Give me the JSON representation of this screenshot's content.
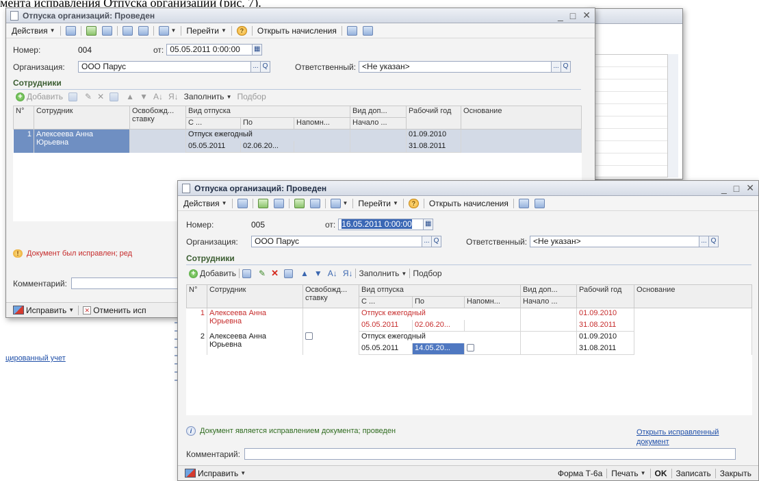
{
  "page_text": "мента исправления Отпуска организаций (рис. 7).",
  "background": {
    "link_text": "цированный учет"
  },
  "win1": {
    "title": "Отпуска организаций: Проведен",
    "toolbar": {
      "actions": "Действия",
      "goto": "Перейти",
      "open_accruals": "Открыть начисления"
    },
    "number_label": "Номер:",
    "number_value": "004",
    "date_label": "от:",
    "date_value": "05.05.2011  0:00:00",
    "org_label": "Организация:",
    "org_value": "ООО Парус",
    "resp_label": "Ответственный:",
    "resp_value": "<Не указан>",
    "section": "Сотрудники",
    "grid_toolbar": {
      "add": "Добавить",
      "fill": "Заполнить",
      "pick": "Подбор"
    },
    "columns": {
      "n": "N°",
      "employee": "Сотрудник",
      "release": "Освобожд... ставку",
      "vac_type": "Вид отпуска",
      "vac_from": "С ...",
      "vac_to": "По",
      "remind": "Напомн...",
      "extra": "Вид доп...",
      "extra_start": "Начало ...",
      "work_year": "Рабочий год",
      "basis": "Основание"
    },
    "rows": [
      {
        "n": "1",
        "employee": "Алексеева Анна Юрьевна",
        "vac_type": "Отпуск ежегодный",
        "from": "05.05.2011",
        "to": "02.06.20...",
        "year_start": "01.09.2010",
        "year_end": "31.08.2011"
      }
    ],
    "status": "Документ был исправлен; ред",
    "comment_label": "Комментарий:",
    "bottom": {
      "fix": "Исправить",
      "cancel": "Отменить исп"
    }
  },
  "win2": {
    "title": "Отпуска организаций: Проведен",
    "toolbar": {
      "actions": "Действия",
      "goto": "Перейти",
      "open_accruals": "Открыть начисления"
    },
    "number_label": "Номер:",
    "number_value": "005",
    "date_label": "от:",
    "date_value": "16.05.2011  0:00:00",
    "org_label": "Организация:",
    "org_value": "ООО Парус",
    "resp_label": "Ответственный:",
    "resp_value": "<Не указан>",
    "section": "Сотрудники",
    "grid_toolbar": {
      "add": "Добавить",
      "fill": "Заполнить",
      "pick": "Подбор"
    },
    "columns": {
      "n": "N°",
      "employee": "Сотрудник",
      "release": "Освобожд... ставку",
      "vac_type": "Вид отпуска",
      "vac_from": "С ...",
      "vac_to": "По",
      "remind": "Напомн...",
      "extra": "Вид доп...",
      "extra_start": "Начало ...",
      "work_year": "Рабочий год",
      "basis": "Основание"
    },
    "rows": [
      {
        "n": "1",
        "employee": "Алексеева Анна Юрьевна",
        "vac_type": "Отпуск ежегодный",
        "from": "05.05.2011",
        "to": "02.06.20...",
        "year_start": "01.09.2010",
        "year_end": "31.08.2011"
      },
      {
        "n": "2",
        "employee": "Алексеева Анна Юрьевна",
        "vac_type": "Отпуск ежегодный",
        "from": "05.05.2011",
        "to": "14.05.20...",
        "year_start": "01.09.2010",
        "year_end": "31.08.2011"
      }
    ],
    "status": "Документ является исправлением документа; проведен",
    "open_fixed_link": "Открыть исправленный документ",
    "comment_label": "Комментарий:",
    "bottom": {
      "fix": "Исправить",
      "form": "Форма Т-6а",
      "print": "Печать",
      "ok": "OK",
      "save": "Записать",
      "close": "Закрыть"
    }
  },
  "colors": {
    "section_title": "#3b5d31",
    "corrected_row_text": "#c62b2b",
    "selection": "#3a67b5",
    "link": "#1f4fa8"
  }
}
